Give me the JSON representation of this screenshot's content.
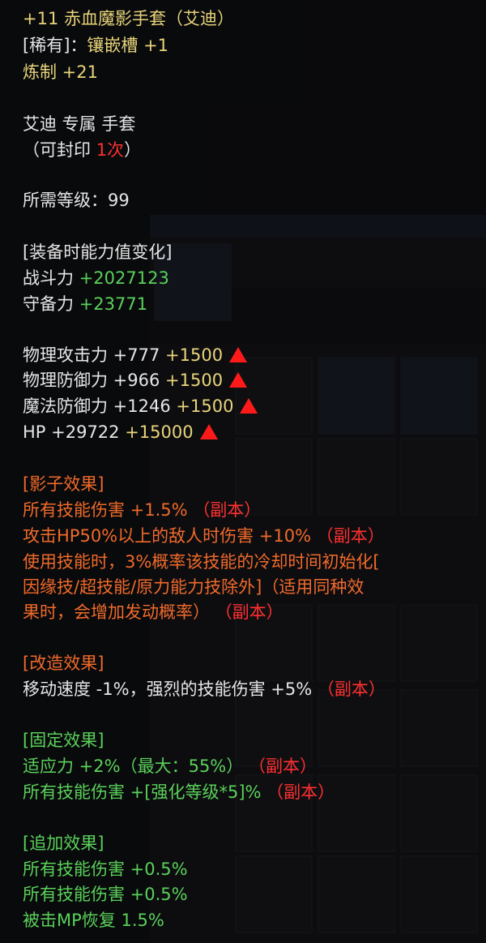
{
  "item": {
    "name": "+11 赤血魔影手套（艾迪）",
    "rarity": "[稀有]",
    "rarity_sep": "：",
    "socket": "镶嵌槽 +1",
    "refine": "炼制 +21",
    "class_type": "艾迪 专属 手套",
    "seal_prefix": "（可封印 ",
    "seal_count": "1次",
    "seal_suffix": "）",
    "level_req": "所需等级：99"
  },
  "stat_change": {
    "header": "[装备时能力值变化]",
    "combat_label": "战斗力",
    "combat_value": "+2027123",
    "defense_label": "守备力",
    "defense_value": "+23771"
  },
  "stats": [
    {
      "label": "物理攻击力 +777",
      "bonus": "+1500"
    },
    {
      "label": "物理防御力 +966",
      "bonus": "+1500"
    },
    {
      "label": "魔法防御力 +1246",
      "bonus": "+1500"
    },
    {
      "label": "HP +29722",
      "bonus": "+15000"
    }
  ],
  "shadow": {
    "header": "[影子效果]",
    "line1": "所有技能伤害 +1.5%",
    "line1_tag": "（副本）",
    "line2": "攻击HP50%以上的敌人时伤害 +10%",
    "line2_tag": "（副本）",
    "line3a": "使用技能时，3%概率该技能的冷却时间初始化[",
    "line3b": "因缘技/超技能/原力能力技除外]（适用同种效",
    "line3c": "果时，会增加发动概率）",
    "line3_tag": "（副本）"
  },
  "modify": {
    "header": "[改造效果]",
    "line1": "移动速度 -1%，强烈的技能伤害 +5%",
    "line1_tag": "（副本）"
  },
  "fixed": {
    "header": "[固定效果]",
    "line1": "适应力 +2%（最大：55%）",
    "line1_tag": "（副本）",
    "line2": "所有技能伤害 +[强化等级*5]%",
    "line2_tag": "（副本）"
  },
  "extra": {
    "header": "[追加效果]",
    "lines": [
      "所有技能伤害 +0.5%",
      "所有技能伤害 +0.5%",
      "被击MP恢复 1.5%"
    ]
  },
  "colors": {
    "white": "#e6e6e6",
    "gold": "#e8d47a",
    "green": "#5ad15a",
    "orange": "#f06a2a",
    "red": "#ff3030"
  }
}
